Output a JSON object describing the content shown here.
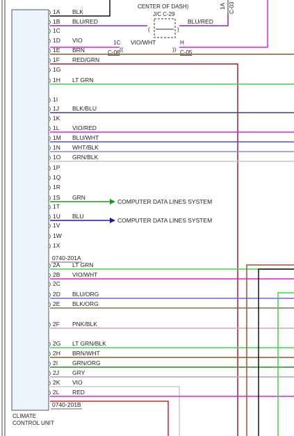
{
  "module": {
    "name_line1": "CLIMATE",
    "name_line2": "CONTROL UNIT",
    "fill_color": "#eaf6fb",
    "connector1": "0740-201A",
    "connector2": "0740-201B"
  },
  "junction": {
    "location": "CENTER OF DASH)",
    "label": "J/C C-29"
  },
  "top_right": {
    "vertical1": "1A",
    "vertical2": "C-03"
  },
  "inline_connector": {
    "left_pin": "1C",
    "left_conn": "C-08",
    "right_pin": "H",
    "right_conn": "C-05"
  },
  "highlight_color": "#ffff00",
  "pins": [
    {
      "id": "1A",
      "wire": "BLK",
      "color": "#111111",
      "len": "short"
    },
    {
      "id": "1B",
      "wire": "BLU/RED",
      "color": "#7b2fb0",
      "len": "junction",
      "highlight": true
    },
    {
      "id": "1C",
      "wire": "",
      "color": "",
      "len": "none"
    },
    {
      "id": "1D",
      "wire": "VIO",
      "color": "#e020e0",
      "len": "inline",
      "highlight": true
    },
    {
      "id": "1E",
      "wire": "BRN",
      "color": "#8b5a2b",
      "len": "full"
    },
    {
      "id": "1F",
      "wire": "RED/GRN",
      "color": "#a02020",
      "len": "drop"
    },
    {
      "id": "1G",
      "wire": "",
      "color": "",
      "len": "none"
    },
    {
      "id": "1H",
      "wire": "LT GRN",
      "color": "#3fd44f",
      "len": "full"
    },
    {
      "id": "1I",
      "wire": "",
      "color": "",
      "len": "none"
    },
    {
      "id": "1J",
      "wire": "BLK/BLU",
      "color": "#3a3f8a",
      "len": "full"
    },
    {
      "id": "1K",
      "wire": "",
      "color": "",
      "len": "none"
    },
    {
      "id": "1L",
      "wire": "VIO/RED",
      "color": "#e020e0",
      "len": "full"
    },
    {
      "id": "1M",
      "wire": "BLU/WHT",
      "color": "#4a4aff",
      "len": "full"
    },
    {
      "id": "1N",
      "wire": "WHT/BLK",
      "color": "#8a8ad8",
      "len": "full"
    },
    {
      "id": "1O",
      "wire": "GRN/BLK",
      "color": "#c8c8c8",
      "len": "full"
    },
    {
      "id": "1P",
      "wire": "",
      "color": "",
      "len": "none"
    },
    {
      "id": "1Q",
      "wire": "",
      "color": "",
      "len": "none"
    },
    {
      "id": "1R",
      "wire": "",
      "color": "",
      "len": "none"
    },
    {
      "id": "1S",
      "wire": "GRN",
      "color": "#1a9a1a",
      "len": "arrow",
      "dest": "COMPUTER DATA LINES SYSTEM"
    },
    {
      "id": "1T",
      "wire": "",
      "color": "",
      "len": "none"
    },
    {
      "id": "1U",
      "wire": "BLU",
      "color": "#1a1aa0",
      "len": "arrow",
      "dest": "COMPUTER DATA LINES SYSTEM"
    },
    {
      "id": "1V",
      "wire": "",
      "color": "",
      "len": "none"
    },
    {
      "id": "1W",
      "wire": "",
      "color": "",
      "len": "none"
    },
    {
      "id": "1X",
      "wire": "",
      "color": "",
      "len": "none"
    },
    {
      "id": "2A",
      "wire": "LT GRN",
      "color": "#3fd44f",
      "len": "full"
    },
    {
      "id": "2B",
      "wire": "VIO/WHT",
      "color": "#e020e0",
      "len": "full"
    },
    {
      "id": "2C",
      "wire": "",
      "color": "",
      "len": "none"
    },
    {
      "id": "2D",
      "wire": "BLU/ORG",
      "color": "#6a6ad0",
      "len": "full"
    },
    {
      "id": "2E",
      "wire": "BLK/ORG",
      "color": "#8b6a4a",
      "len": "full"
    },
    {
      "id": "2F",
      "wire": "PNK/BLK",
      "color": "#d8a0b8",
      "len": "full"
    },
    {
      "id": "2G",
      "wire": "LT GRN/BLK",
      "color": "#3fd44f",
      "len": "full"
    },
    {
      "id": "2H",
      "wire": "BRN/WHT",
      "color": "#8b5a2b",
      "len": "full"
    },
    {
      "id": "2I",
      "wire": "GRN/ORG",
      "color": "#2a8a2a",
      "len": "full"
    },
    {
      "id": "2J",
      "wire": "GRY",
      "color": "#aaaaaa",
      "len": "full"
    },
    {
      "id": "2K",
      "wire": "VIO",
      "color": "#c8c8c8",
      "len": "drop"
    },
    {
      "id": "2L",
      "wire": "RED",
      "color": "#e020e0",
      "len": "full"
    }
  ],
  "bottom_red_wire_color": "#e02020"
}
